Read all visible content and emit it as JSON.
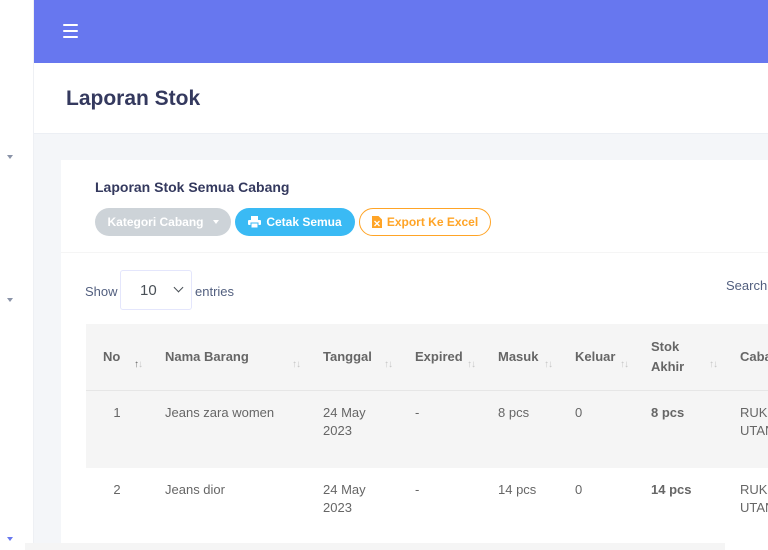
{
  "page": {
    "title": "Laporan Stok"
  },
  "card": {
    "title": "Laporan Stok Semua Cabang",
    "buttons": {
      "kategori": "Kategori Cabang",
      "cetak": "Cetak Semua",
      "excel": "Export Ke Excel"
    }
  },
  "datatable": {
    "show_label": "Show",
    "page_size": "10",
    "entries_label": "entries",
    "search_label": "Search:",
    "columns": [
      "No",
      "Nama Barang",
      "Tanggal",
      "Expired",
      "Masuk",
      "Keluar",
      "Stok Akhir",
      "Caba"
    ],
    "rows": [
      {
        "no": "1",
        "nama": "Jeans zara women",
        "tanggal": "24 May 2023",
        "expired": "-",
        "masuk": "8 pcs",
        "keluar": "0",
        "stok_akhir": "8 pcs",
        "cabang": "RUKO UTAN"
      },
      {
        "no": "2",
        "nama": "Jeans dior",
        "tanggal": "24 May 2023",
        "expired": "-",
        "masuk": "14 pcs",
        "keluar": "0",
        "stok_akhir": "14 pcs",
        "cabang": "RUKO UTAN"
      }
    ]
  },
  "colors": {
    "topbar": "#6777ef",
    "primary_info": "#3abaf4",
    "warning": "#ffa426",
    "light": "#cdd3d8"
  },
  "icons": {
    "menu": "hamburger-icon",
    "print": "print-icon",
    "excel": "file-excel-icon",
    "sort": "sort-icon"
  }
}
